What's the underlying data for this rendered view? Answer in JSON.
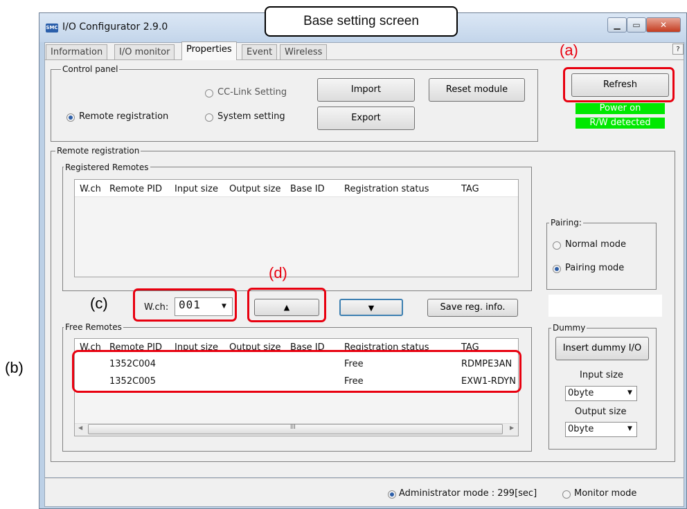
{
  "window": {
    "title": "I/O Configurator 2.9.0",
    "app_icon": "app-icon",
    "help": "?"
  },
  "callouts": {
    "base": "Base setting screen",
    "a": "(a)",
    "b": "(b)",
    "c": "(c)",
    "d": "(d)"
  },
  "tabs": [
    "Information",
    "I/O monitor",
    "Properties",
    "Event",
    "Wireless"
  ],
  "active_tab": "Properties",
  "control_panel": {
    "legend": "Control panel",
    "cc_link": "CC-Link Setting",
    "remote_registration": "Remote registration",
    "system_setting": "System setting",
    "selected": "Remote registration",
    "import": "Import",
    "export": "Export",
    "reset_module": "Reset module",
    "refresh": "Refresh",
    "status": [
      "Power on",
      "R/W detected"
    ]
  },
  "remote_registration": {
    "legend": "Remote registration",
    "registered_legend": "Registered Remotes",
    "free_legend": "Free Remotes",
    "columns": [
      "W.ch",
      "Remote PID",
      "Input size",
      "Output size",
      "Base ID",
      "Registration status",
      "TAG"
    ],
    "registered_rows": [],
    "free_rows": [
      {
        "pid": "1352C004",
        "status": "Free",
        "tag": "RDMPE3AN"
      },
      {
        "pid": "1352C005",
        "status": "Free",
        "tag": "EXW1-RDYN"
      }
    ],
    "wch_label": "W.ch:",
    "wch_value": "001",
    "up_arrow": "▲",
    "down_arrow": "▼",
    "save": "Save reg. info.",
    "scroll_grip": "III"
  },
  "pairing": {
    "legend": "Pairing:",
    "normal": "Normal mode",
    "pairing": "Pairing mode",
    "selected": "Pairing mode"
  },
  "dummy": {
    "legend": "Dummy",
    "insert": "Insert dummy I/O",
    "input_label": "Input size",
    "input_value": "0byte",
    "output_label": "Output size",
    "output_value": "0byte"
  },
  "status_bar": {
    "admin": "Administrator mode : 299[sec]",
    "monitor": "Monitor mode",
    "selected": "Administrator mode"
  },
  "colors": {
    "highlight": "#e8000f",
    "status_green": "#00e800",
    "radio_dot": "#2e5fa8"
  }
}
